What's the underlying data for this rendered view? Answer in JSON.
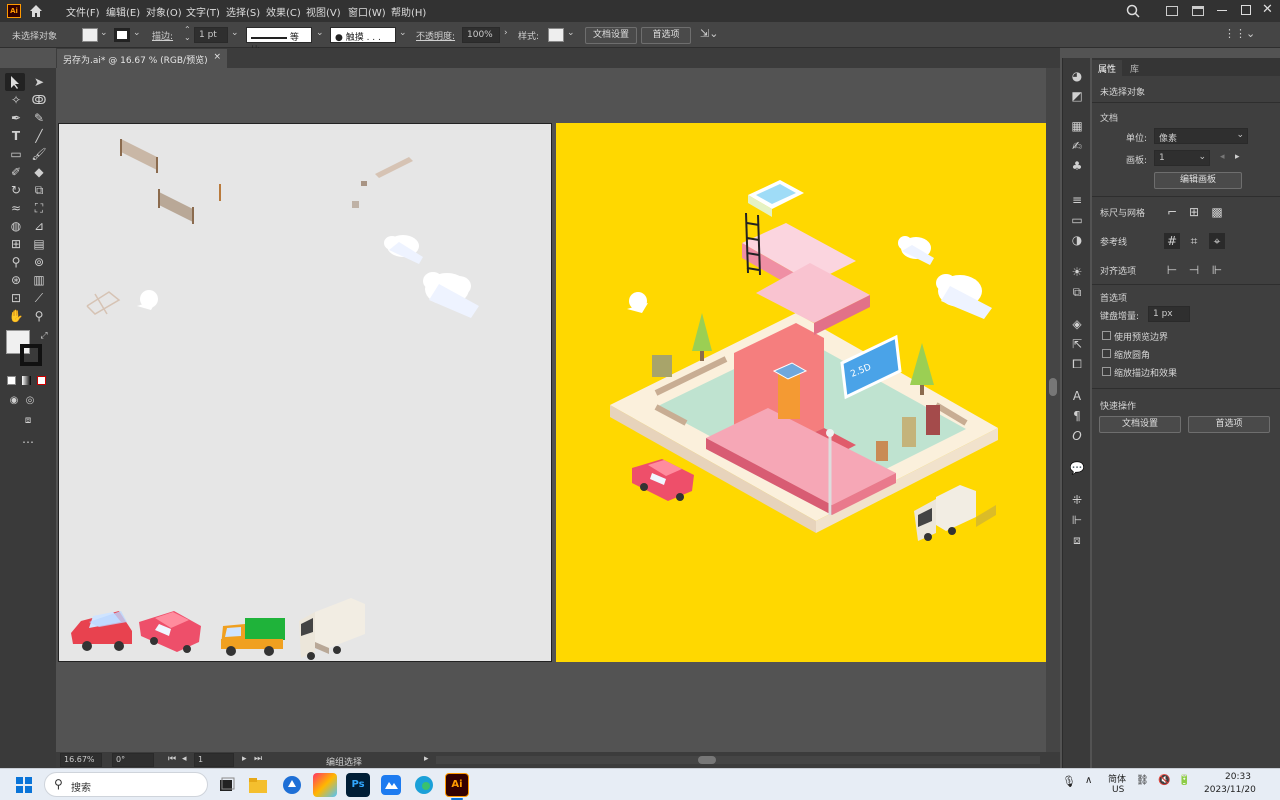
{
  "app": {
    "logo": "Ai",
    "menus": [
      "文件(F)",
      "编辑(E)",
      "对象(O)",
      "文字(T)",
      "选择(S)",
      "效果(C)",
      "视图(V)",
      "窗口(W)",
      "帮助(H)"
    ],
    "icons": [
      "home-icon",
      "search-icon",
      "arrange-documents-icon",
      "window-layout-icon",
      "minimize-icon",
      "maximize-icon",
      "close-icon"
    ]
  },
  "control_bar": {
    "selection_status": "未选择对象",
    "stroke_label": "描边:",
    "stroke_weight": "1 pt",
    "stroke_profile": "等比",
    "brush": "● 触摸 . . .",
    "opacity_label": "不透明度:",
    "opacity_value": "100%",
    "style_label": "样式:",
    "doc_setup_button": "文档设置",
    "prefs_button": "首选项"
  },
  "document": {
    "tab_title": "另存为.ai* @ 16.67 % (RGB/预览)",
    "close": "×"
  },
  "status_bar": {
    "zoom": "16.67%",
    "rotation": "0°",
    "artboard_number": "1",
    "status_text": "编组选择"
  },
  "properties_panel": {
    "tabs": [
      "属性",
      "库"
    ],
    "no_selection": "未选择对象",
    "document_label": "文档",
    "units_label": "单位:",
    "units_value": "像素",
    "artboard_label": "画板:",
    "artboard_value": "1",
    "edit_artboards_button": "编辑画板",
    "rulers_grids_label": "标尺与网格",
    "guides_label": "参考线",
    "align_label": "对齐选项",
    "preferences_label": "首选项",
    "keyboard_increment_label": "键盘增量:",
    "keyboard_increment_value": "1 px",
    "checkboxes": [
      "使用预览边界",
      "缩放圆角",
      "缩放描边和效果"
    ],
    "quick_actions_label": "快速操作",
    "doc_setup_button": "文档设置",
    "prefs_button": "首选项"
  },
  "artwork": {
    "billboard_text": "2.5D"
  },
  "taskbar": {
    "search_placeholder": "搜索",
    "ime_top": "简体",
    "ime_bottom": "US",
    "time": "20:33",
    "date": "2023/11/20",
    "apps": [
      "start-icon",
      "task-view-icon",
      "file-explorer-icon",
      "app-blue-icon",
      "creative-cloud-icon",
      "photoshop-icon",
      "app-cloud-icon",
      "edge-icon",
      "illustrator-icon"
    ],
    "app_labels": {
      "photoshop": "Ps",
      "illustrator": "Ai"
    }
  },
  "colors": {
    "accent_yellow": "#ffd800",
    "artboard_gray": "#e6e6e6",
    "building_pink": "#f28b8b",
    "car_red": "#e8424f",
    "truck_green": "#1fb33a",
    "truck_orange": "#f0a020"
  }
}
